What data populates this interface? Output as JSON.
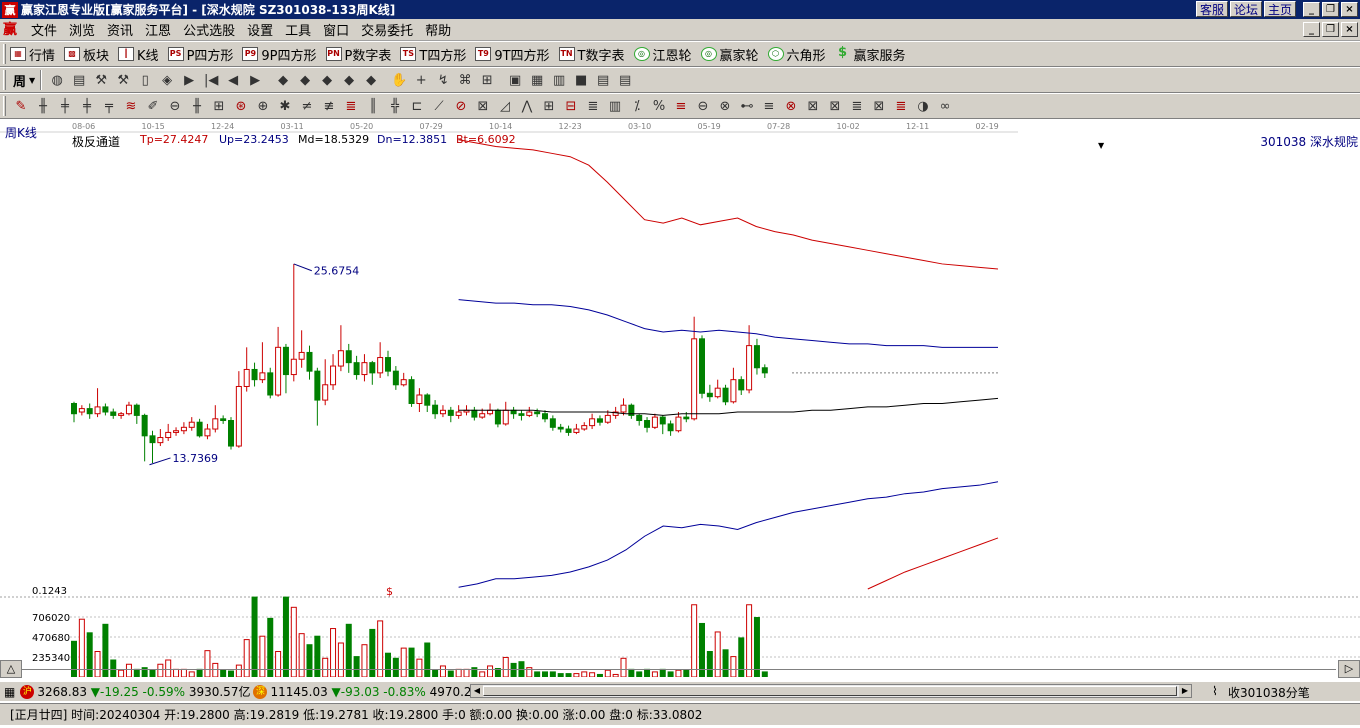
{
  "window": {
    "title": "赢家江恩专业版[赢家服务平台] - [深水规院   SZ301038-133周K线]",
    "links": [
      "客服",
      "论坛",
      "主页"
    ]
  },
  "menu": [
    "文件",
    "浏览",
    "资讯",
    "江恩",
    "公式选股",
    "设置",
    "工具",
    "窗口",
    "交易委托",
    "帮助"
  ],
  "toolbar1": [
    {
      "label": "行情",
      "icon": "grid-icon"
    },
    {
      "label": "板块",
      "icon": "sector-icon"
    },
    {
      "label": "K线",
      "icon": "candle-icon"
    },
    {
      "label": "P四方形",
      "icon": "PS"
    },
    {
      "label": "9P四方形",
      "icon": "P9"
    },
    {
      "label": "P数字表",
      "icon": "PN"
    },
    {
      "label": "T四方形",
      "icon": "TS"
    },
    {
      "label": "9T四方形",
      "icon": "T9"
    },
    {
      "label": "T数字表",
      "icon": "TN"
    },
    {
      "label": "江恩轮",
      "icon": "wheel-icon"
    },
    {
      "label": "赢家轮",
      "icon": "wheel-icon"
    },
    {
      "label": "六角形",
      "icon": "hexagon-icon"
    },
    {
      "label": "赢家服务",
      "icon": "dollar-icon"
    }
  ],
  "toolbar2": {
    "period": "周"
  },
  "chart": {
    "period_label": "周K线",
    "date_ticks": [
      "08-06",
      "10-15",
      "12-24",
      "03-11",
      "05-20",
      "07-29",
      "10-14",
      "12-23",
      "03-10",
      "05-19",
      "07-28",
      "10-02",
      "12-11",
      "02-19"
    ],
    "indicator": {
      "name": "极反通道",
      "tp": "Tp=27.4247",
      "up": "Up=23.2453",
      "md": "Md=18.5329",
      "dn": "Dn=12.3851",
      "bt": "Bt=6.6092"
    },
    "stock": "301038  深水规院",
    "high_label": "25.6754",
    "low_label": "13.7369",
    "volume_axis": {
      "scale_label": "0.1243",
      "marker": "$",
      "ticks": [
        "706020",
        "470680",
        "235340"
      ]
    }
  },
  "chart_data": {
    "type": "candlestick",
    "title": "",
    "price_range": [
      6.6,
      33.1
    ],
    "volume_range": [
      0,
      941360
    ],
    "candles": [
      [
        17.5,
        16.9,
        17.6,
        16.4
      ],
      [
        17.0,
        17.2,
        17.4,
        16.8
      ],
      [
        17.2,
        16.9,
        17.5,
        16.6
      ],
      [
        16.9,
        17.3,
        18.4,
        16.7
      ],
      [
        17.3,
        17.0,
        17.5,
        16.8
      ],
      [
        17.0,
        16.8,
        17.2,
        16.6
      ],
      [
        16.8,
        16.9,
        17.0,
        16.6
      ],
      [
        16.9,
        17.4,
        17.6,
        16.8
      ],
      [
        17.4,
        16.8,
        17.5,
        16.3
      ],
      [
        16.8,
        15.6,
        16.9,
        14.1
      ],
      [
        15.6,
        15.2,
        15.9,
        14.0
      ],
      [
        15.2,
        15.5,
        16.0,
        15.0
      ],
      [
        15.5,
        15.8,
        16.3,
        15.3
      ],
      [
        15.8,
        15.9,
        16.1,
        15.6
      ],
      [
        15.9,
        16.1,
        16.4,
        15.7
      ],
      [
        16.1,
        16.4,
        16.7,
        15.9
      ],
      [
        16.4,
        15.6,
        16.6,
        15.5
      ],
      [
        15.6,
        16.0,
        16.3,
        15.4
      ],
      [
        16.0,
        16.6,
        17.4,
        15.8
      ],
      [
        16.6,
        16.5,
        16.8,
        16.3
      ],
      [
        16.5,
        15.0,
        16.7,
        14.8
      ],
      [
        15.0,
        18.5,
        19.4,
        14.9
      ],
      [
        18.5,
        19.5,
        20.8,
        18.2
      ],
      [
        19.5,
        18.9,
        19.9,
        18.5
      ],
      [
        18.9,
        19.3,
        21.1,
        18.7
      ],
      [
        19.3,
        18.0,
        19.6,
        17.8
      ],
      [
        18.0,
        20.8,
        22.0,
        17.9
      ],
      [
        20.8,
        19.2,
        21.0,
        18.1
      ],
      [
        19.2,
        20.1,
        25.7,
        18.8
      ],
      [
        20.1,
        20.5,
        21.8,
        19.6
      ],
      [
        20.5,
        19.4,
        20.9,
        18.9
      ],
      [
        19.4,
        17.7,
        19.6,
        16.2
      ],
      [
        17.7,
        18.6,
        20.1,
        17.4
      ],
      [
        18.6,
        19.7,
        20.4,
        18.3
      ],
      [
        19.7,
        20.6,
        22.1,
        19.4
      ],
      [
        20.6,
        19.9,
        21.0,
        19.3
      ],
      [
        19.9,
        19.2,
        20.3,
        18.9
      ],
      [
        19.2,
        19.9,
        20.4,
        18.8
      ],
      [
        19.9,
        19.3,
        20.0,
        18.6
      ],
      [
        19.3,
        20.2,
        21.1,
        19.0
      ],
      [
        20.2,
        19.4,
        20.6,
        19.1
      ],
      [
        19.4,
        18.6,
        19.7,
        18.3
      ],
      [
        18.6,
        18.9,
        19.3,
        18.5
      ],
      [
        18.9,
        17.5,
        19.1,
        17.3
      ],
      [
        17.5,
        18.0,
        18.4,
        17.0
      ],
      [
        18.0,
        17.4,
        18.1,
        17.0
      ],
      [
        17.4,
        16.9,
        17.7,
        16.6
      ],
      [
        16.9,
        17.1,
        17.4,
        16.7
      ],
      [
        17.1,
        16.8,
        17.3,
        16.4
      ],
      [
        16.8,
        17.0,
        17.4,
        16.6
      ],
      [
        17.0,
        17.1,
        17.4,
        16.8
      ],
      [
        17.1,
        16.7,
        17.3,
        16.5
      ],
      [
        16.7,
        16.9,
        17.2,
        16.6
      ],
      [
        16.9,
        17.1,
        17.5,
        16.8
      ],
      [
        17.1,
        16.3,
        17.2,
        16.1
      ],
      [
        16.3,
        17.1,
        17.6,
        16.2
      ],
      [
        17.1,
        16.9,
        17.3,
        16.6
      ],
      [
        16.9,
        16.8,
        17.1,
        16.5
      ],
      [
        16.8,
        17.0,
        17.3,
        16.7
      ],
      [
        17.0,
        16.9,
        17.2,
        16.7
      ],
      [
        16.9,
        16.6,
        17.1,
        16.4
      ],
      [
        16.6,
        16.1,
        16.8,
        15.9
      ],
      [
        16.1,
        16.0,
        16.3,
        15.8
      ],
      [
        16.0,
        15.8,
        16.2,
        15.6
      ],
      [
        15.8,
        16.0,
        16.3,
        15.7
      ],
      [
        16.0,
        16.2,
        16.4,
        15.9
      ],
      [
        16.2,
        16.6,
        16.9,
        16.0
      ],
      [
        16.6,
        16.4,
        16.8,
        16.2
      ],
      [
        16.4,
        16.8,
        17.1,
        16.3
      ],
      [
        16.8,
        17.0,
        17.3,
        16.6
      ],
      [
        17.0,
        17.4,
        17.8,
        16.8
      ],
      [
        17.4,
        16.8,
        17.5,
        16.6
      ],
      [
        16.8,
        16.5,
        16.9,
        16.2
      ],
      [
        16.5,
        16.1,
        16.7,
        15.8
      ],
      [
        16.1,
        16.7,
        16.9,
        16.0
      ],
      [
        16.7,
        16.3,
        16.8,
        15.7
      ],
      [
        16.3,
        15.9,
        16.5,
        15.6
      ],
      [
        15.9,
        16.7,
        17.0,
        15.8
      ],
      [
        16.7,
        16.6,
        17.0,
        16.4
      ],
      [
        16.6,
        21.3,
        22.6,
        16.5
      ],
      [
        21.3,
        18.1,
        21.5,
        17.8
      ],
      [
        18.1,
        17.9,
        18.6,
        17.6
      ],
      [
        17.9,
        18.4,
        18.9,
        17.8
      ],
      [
        18.4,
        17.6,
        18.6,
        17.4
      ],
      [
        17.6,
        18.9,
        19.6,
        17.5
      ],
      [
        18.9,
        18.3,
        19.1,
        18.0
      ],
      [
        18.3,
        20.9,
        22.1,
        18.1
      ],
      [
        20.9,
        19.6,
        21.3,
        19.2
      ],
      [
        19.6,
        19.3,
        19.8,
        19.0
      ]
    ],
    "volumes": [
      420000,
      680000,
      520000,
      300000,
      620000,
      200000,
      80000,
      150000,
      90000,
      110000,
      80000,
      150000,
      200000,
      90000,
      90000,
      60000,
      90000,
      310000,
      160000,
      80000,
      70000,
      140000,
      440000,
      940000,
      480000,
      690000,
      300000,
      940000,
      820000,
      510000,
      380000,
      480000,
      220000,
      570000,
      400000,
      620000,
      240000,
      380000,
      560000,
      660000,
      280000,
      220000,
      340000,
      340000,
      210000,
      400000,
      80000,
      130000,
      70000,
      90000,
      90000,
      110000,
      60000,
      130000,
      100000,
      230000,
      160000,
      180000,
      110000,
      60000,
      60000,
      60000,
      40000,
      40000,
      40000,
      60000,
      50000,
      30000,
      80000,
      30000,
      220000,
      90000,
      60000,
      90000,
      60000,
      90000,
      60000,
      80000,
      80000,
      850000,
      630000,
      300000,
      530000,
      320000,
      240000,
      460000,
      850000,
      700000,
      60000
    ],
    "channels": [
      {
        "name": "Tp",
        "color": "#cc0000"
      },
      {
        "name": "Up",
        "color": "#000099"
      },
      {
        "name": "Md",
        "color": "#000000"
      },
      {
        "name": "Dn",
        "color": "#000099"
      },
      {
        "name": "Bt",
        "color": "#cc0000"
      }
    ],
    "up_color": "#cc0000",
    "down_color": "#008000"
  },
  "status1": {
    "sh_badge": "沪",
    "sh_index": "3268.83",
    "sh_change": "▼-19.25",
    "sh_pct": "-0.59%",
    "sh_amount": "3930.57亿",
    "sz_badge": "深",
    "sz_index": "11145.03",
    "sz_change": "▼-93.03",
    "sz_pct": "-0.83%",
    "sz_amount": "4970.2",
    "right_text": "收301038分笔"
  },
  "status2": {
    "text": "[正月廿四] 时间:20240304 开:19.2800 高:19.2819 低:19.2781 收:19.2800 手:0 额:0.00 换:0.00 涨:0.00 盘:0 标:33.0802"
  }
}
